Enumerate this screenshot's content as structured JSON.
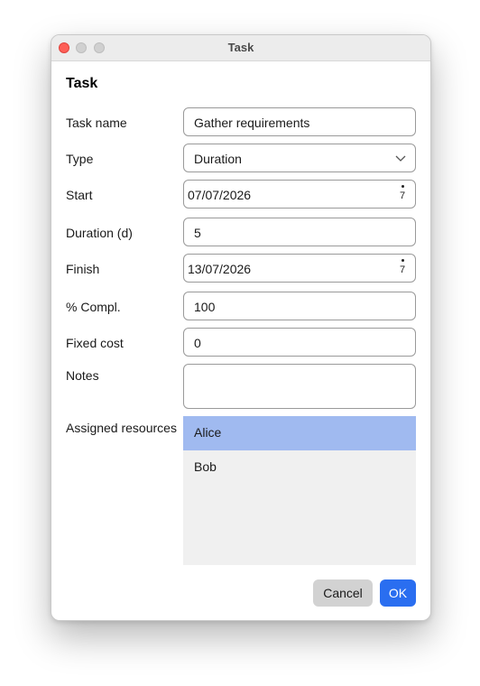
{
  "window": {
    "title": "Task"
  },
  "dialog": {
    "heading": "Task"
  },
  "form": {
    "task_name": {
      "label": "Task name",
      "value": "Gather requirements"
    },
    "type": {
      "label": "Type",
      "value": "Duration"
    },
    "start": {
      "label": "Start",
      "value": "07/07/2026",
      "spinner_text": "7"
    },
    "duration": {
      "label": "Duration (d)",
      "value": "5"
    },
    "finish": {
      "label": "Finish",
      "value": "13/07/2026",
      "spinner_text": "7"
    },
    "percent_complete": {
      "label": "% Compl.",
      "value": "100"
    },
    "fixed_cost": {
      "label": "Fixed cost",
      "value": "0"
    },
    "notes": {
      "label": "Notes",
      "value": ""
    },
    "assigned_resources": {
      "label": "Assigned resources",
      "items": [
        {
          "label": "Alice",
          "selected": true
        },
        {
          "label": "Bob",
          "selected": false
        }
      ]
    }
  },
  "buttons": {
    "cancel_label": "Cancel",
    "ok_label": "OK"
  },
  "colors": {
    "accent": "#2a6ef0",
    "selection": "#a0baf0",
    "close": "#fe5f57"
  }
}
